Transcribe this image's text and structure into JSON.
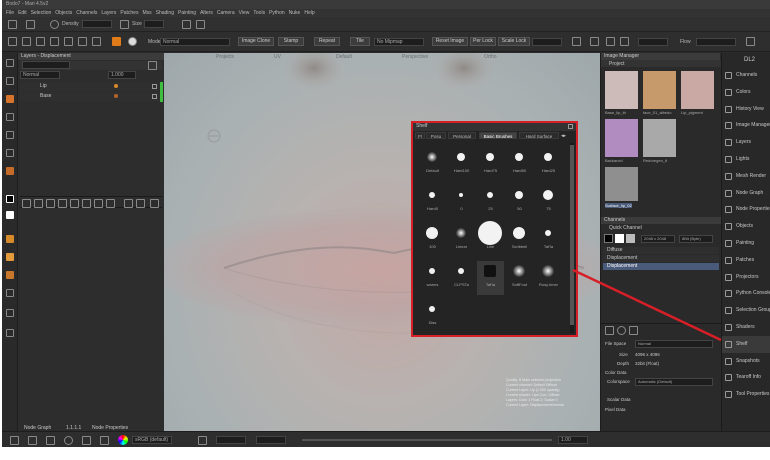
{
  "window": {
    "title": "Bodo7 - Mari 4.5v2"
  },
  "menu": [
    "File",
    "Edit",
    "Selection",
    "Objects",
    "Channels",
    "Layers",
    "Patches",
    "Mss",
    "Shading",
    "Painting",
    "Alters",
    "Camera",
    "View",
    "Tools",
    "Python",
    "Nuke",
    "Help"
  ],
  "toolbar": {
    "density_label": "Density",
    "size_label": "Size",
    "mode_label": "Mode",
    "mode_value": "Normal",
    "image_clone_btn": "Image Clone",
    "stamp_btn": "Stamp",
    "repeat_btn": "Repeat",
    "tile_btn": "Tile",
    "no_mipmap_value": "No Mipmap",
    "reset_image_btn": "Reset Image",
    "per_lock_btn": "Per Lock",
    "scale_lock_btn": "Scale Lock",
    "flow_label": "Flow"
  },
  "layers_panel": {
    "title": "Layers - Displacement",
    "blend_value": "Normal",
    "opacity_value": "1.000",
    "layers": [
      {
        "name": "Lip"
      },
      {
        "name": "Base"
      }
    ]
  },
  "viewport": {
    "tabs": [
      "Projects",
      "UV",
      "Default",
      "Perspective",
      "Ortho"
    ]
  },
  "shelf": {
    "title": "Shelf",
    "tabs": [
      "Fl",
      "Posu",
      "Personal",
      "Basic Brushes",
      "Hard Surface"
    ],
    "active_tab": "Basic Brushes",
    "brushes": [
      {
        "label": "Default",
        "icon": "soft-round-brush-icon"
      },
      {
        "label": "Hard100",
        "icon": "hard-round-brush-icon"
      },
      {
        "label": "Hard75",
        "icon": "hard-round-brush-icon"
      },
      {
        "label": "Hard50",
        "icon": "hard-round-brush-icon"
      },
      {
        "label": "Hard25",
        "icon": "hard-round-brush-icon"
      },
      {
        "label": "Hard0",
        "icon": "round-brush-icon"
      },
      {
        "label": "0",
        "icon": "round-brush-icon"
      },
      {
        "label": "25",
        "icon": "round-brush-icon"
      },
      {
        "label": "50",
        "icon": "round-brush-icon"
      },
      {
        "label": "75",
        "icon": "round-brush-icon"
      },
      {
        "label": "100",
        "icon": "large-round-brush-icon"
      },
      {
        "label": "Linear",
        "icon": "soft-brush-icon"
      },
      {
        "label": "Line",
        "icon": "large-hard-brush-icon"
      },
      {
        "label": "Scribbeli",
        "icon": "hard-brush-icon"
      },
      {
        "label": "Taf'la",
        "icon": "star-brush-icon"
      },
      {
        "label": "warms",
        "icon": "spray-brush-icon"
      },
      {
        "label": "CLPSTa",
        "icon": "spray-brush-icon"
      },
      {
        "label": "Taf'ia",
        "icon": "custom-brush-icon"
      },
      {
        "label": "SoftFout",
        "icon": "soft-brush-icon"
      },
      {
        "label": "Rosy.Inner",
        "icon": "soft-brush-icon"
      },
      {
        "label": "Diss",
        "icon": "small-brush-icon"
      }
    ]
  },
  "image_manager": {
    "title": "Image Manager",
    "project_label": "Project",
    "images": [
      {
        "label": "Base_lip_th",
        "color": "#cdbbb9"
      },
      {
        "label": "face_01_albedo",
        "color": "#c79a6c"
      },
      {
        "label": "Lip_pigment",
        "color": "#caa8a4"
      },
      {
        "label": "Backarcid",
        "color": "#b08cc0"
      },
      {
        "label": "Redoregen_lt",
        "color": "#a9a9a9"
      },
      {
        "label": "Surface_lip_02",
        "color": "#8f8f8f"
      }
    ]
  },
  "channels_panel": {
    "title": "Channels",
    "quick_channel": "Quick Channel",
    "resolution": "2048 x 2048",
    "depth": "8Bit (Byte)",
    "channels": [
      {
        "name": "Diffuse"
      },
      {
        "name": "Displacement"
      },
      {
        "name": "Displacement"
      }
    ]
  },
  "properties_panel": {
    "file_space_label": "File Space",
    "file_space_value": "Normal",
    "size_label": "Size",
    "size_value": "4096 x 4096",
    "depth_label": "Depth",
    "depth_value": "32bit (Float)",
    "color_data_label": "Color Data",
    "colorspace_label": "Colorspace",
    "colorspace_value": "Automatic (Default)",
    "scalar_data_label": "Scalar Data",
    "pixel_data_label": "Pixel Data"
  },
  "side_tabs": [
    {
      "label": "Channels",
      "icon": "channels-icon"
    },
    {
      "label": "Colors",
      "icon": "colors-icon"
    },
    {
      "label": "History View",
      "icon": "history-icon"
    },
    {
      "label": "Image Manager",
      "icon": "image-manager-icon"
    },
    {
      "label": "Layers",
      "icon": "layers-icon"
    },
    {
      "label": "Lights",
      "icon": "lights-icon"
    },
    {
      "label": "Mesh Render",
      "icon": "mesh-render-icon"
    },
    {
      "label": "Node Graph",
      "icon": "node-graph-icon"
    },
    {
      "label": "Node Properties",
      "icon": "node-properties-icon"
    },
    {
      "label": "Objects",
      "icon": "objects-icon"
    },
    {
      "label": "Painting",
      "icon": "painting-icon"
    },
    {
      "label": "Patches",
      "icon": "patches-icon"
    },
    {
      "label": "Projectors",
      "icon": "projectors-icon"
    },
    {
      "label": "Python Console",
      "icon": "python-console-icon"
    },
    {
      "label": "Selection Groups",
      "icon": "selection-groups-icon"
    },
    {
      "label": "Shaders",
      "icon": "shaders-icon"
    },
    {
      "label": "Shelf",
      "icon": "shelf-icon",
      "highlighted": true
    },
    {
      "label": "Snapshots",
      "icon": "snapshots-icon"
    },
    {
      "label": "Tearoff Info",
      "icon": "tearoff-info-icon"
    },
    {
      "label": "Tool Properties",
      "icon": "tool-properties-icon"
    }
  ],
  "viewport_info": [
    "Quality: 6 Main selected projection",
    "Current channel: Default Diffuse",
    "Current Layer: Lip (1.000 opacity)",
    "Current shader: Lips Curr. Diffuse",
    "Layers: Color 1 Float 2: Scalar 0",
    "Current Layer: Displacement/normal"
  ],
  "bottom": {
    "node_graph_label": "Node Graph",
    "node_properties_label": "Node Properties",
    "version_label": "1.1.1.1",
    "colorspace_value": "sRGB (default)",
    "zoom_value": "1.00"
  },
  "colors": {
    "highlight_red": "#d61f27",
    "panel_bg": "#2b2b2b",
    "accent_green": "#3fbf3f",
    "selected_row": "#4a5a7a"
  }
}
